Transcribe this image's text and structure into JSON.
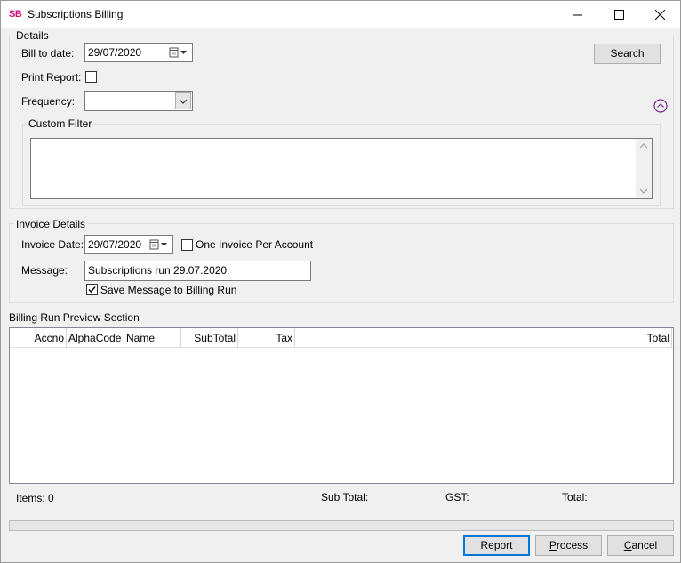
{
  "window": {
    "icon_text": "SB",
    "title": "Subscriptions Billing"
  },
  "details": {
    "group_title": "Details",
    "bill_to_date_label": "Bill to date:",
    "bill_to_date_value": "29/07/2020",
    "print_report_label": "Print Report:",
    "print_report_checked": false,
    "frequency_label": "Frequency:",
    "frequency_value": "",
    "search_label": "Search",
    "custom_filter_title": "Custom Filter",
    "custom_filter_value": ""
  },
  "invoice": {
    "group_title": "Invoice Details",
    "invoice_date_label": "Invoice Date:",
    "invoice_date_value": "29/07/2020",
    "one_invoice_label": "One Invoice Per Account",
    "one_invoice_checked": false,
    "message_label": "Message:",
    "message_value": "Subscriptions run 29.07.2020",
    "save_message_label": "Save Message to Billing Run",
    "save_message_checked": true
  },
  "preview": {
    "section_title": "Billing Run Preview Section",
    "columns": [
      "Accno",
      "AlphaCode",
      "Name",
      "SubTotal",
      "Tax",
      "Total"
    ],
    "rows": []
  },
  "summary": {
    "items_label": "Items:",
    "items_value": "0",
    "subtotal_label": "Sub Total:",
    "gst_label": "GST:",
    "total_label": "Total:"
  },
  "progress": 0,
  "buttons": {
    "report": "Report",
    "process": "Process",
    "cancel": "Cancel"
  }
}
